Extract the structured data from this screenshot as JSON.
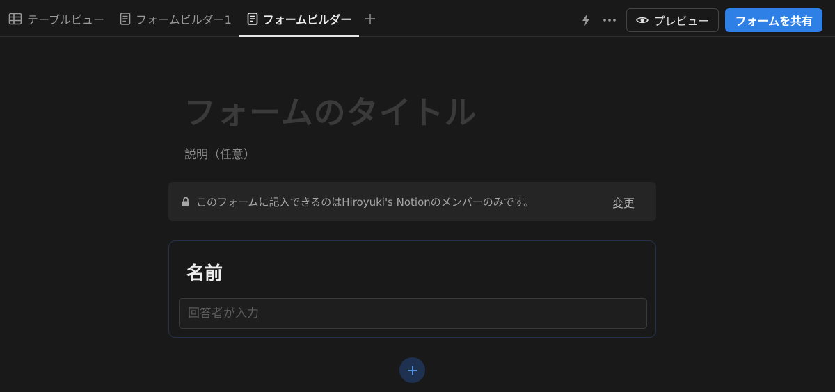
{
  "tabs": [
    {
      "label": "テーブルビュー",
      "icon": "table-icon",
      "active": false
    },
    {
      "label": "フォームビルダー1",
      "icon": "form-icon",
      "active": false
    },
    {
      "label": "フォームビルダー",
      "icon": "form-icon",
      "active": true
    }
  ],
  "toolbar": {
    "add_tab_icon": "plus-icon",
    "automation_icon": "bolt-icon",
    "more_icon": "more-icon",
    "preview_label": "プレビュー",
    "share_label": "フォームを共有"
  },
  "form": {
    "title_placeholder": "フォームのタイトル",
    "description_placeholder": "説明（任意）",
    "notice": {
      "text": "このフォームに記入できるのはHiroyuki's Notionのメンバーのみです。",
      "action": "変更"
    },
    "question": {
      "label": "名前",
      "answer_placeholder": "回答者が入力"
    },
    "add_question_icon": "plus-icon"
  },
  "colors": {
    "background": "#191919",
    "accent": "#2f80e6",
    "card_border": "#23324a",
    "notice_bg": "#252525"
  }
}
